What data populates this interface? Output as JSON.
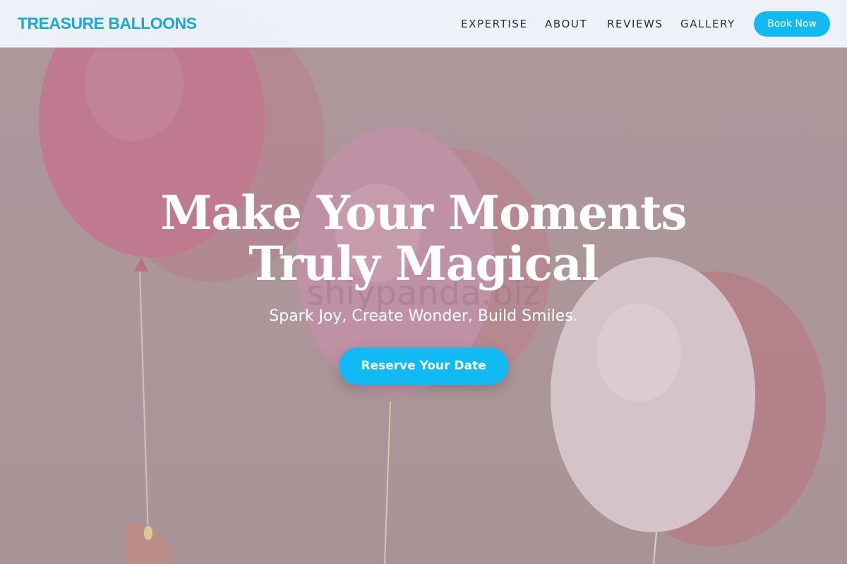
{
  "navbar": {
    "brand": "TREASURE BALLOONS",
    "links": [
      "EXPERTISE",
      "ABOUT",
      "REVIEWS",
      "GALLERY"
    ],
    "book_label": "Book Now"
  },
  "hero": {
    "headline_line1": "Make Your Moments",
    "headline_line2": "Truly Magical",
    "subtitle": "Spark Joy, Create Wonder, Build Smiles.",
    "cta_label": "Reserve Your Date",
    "watermark": "shiypanda.biz"
  },
  "colors": {
    "accent": "#12baf4",
    "brand": "#1aa7de",
    "nav_bg": "#eff4fb",
    "hero_bg": "#b19da0"
  },
  "icons": [
    "balloon-image"
  ]
}
